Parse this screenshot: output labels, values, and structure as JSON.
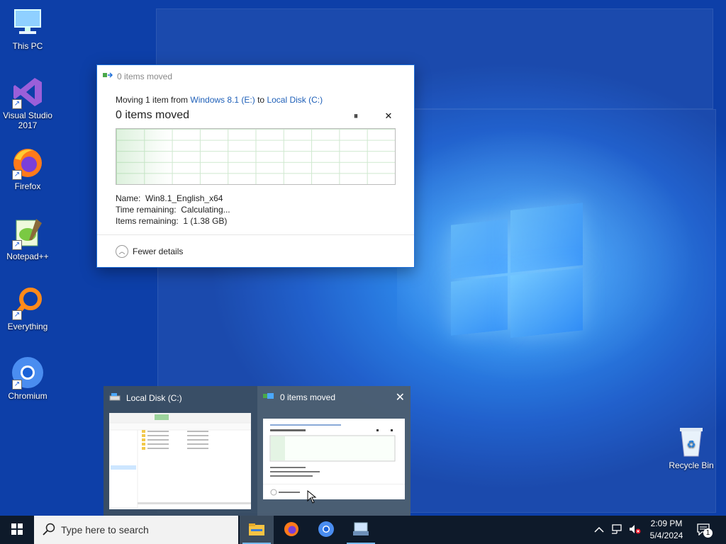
{
  "desktop_icons": [
    {
      "label": "This PC",
      "icon": "computer-icon"
    },
    {
      "label": "Visual Studio 2017",
      "icon": "visual-studio-icon"
    },
    {
      "label": "Firefox",
      "icon": "firefox-icon"
    },
    {
      "label": "Notepad++",
      "icon": "notepadpp-icon"
    },
    {
      "label": "Everything",
      "icon": "search-magnifier-icon"
    },
    {
      "label": "Chromium",
      "icon": "chromium-icon"
    },
    {
      "label": "Recycle Bin",
      "icon": "recycle-bin-icon"
    }
  ],
  "copy_dialog": {
    "title": "0 items moved",
    "moving_prefix": "Moving 1 item from",
    "source": "Windows 8.1 (E:)",
    "to_word": "to",
    "destination": "Local Disk (C:)",
    "heading": "0 items moved",
    "pause_glyph": "⏸",
    "close_glyph": "✕",
    "name_label": "Name:",
    "name_value": "Win8.1_English_x64",
    "time_label": "Time remaining:",
    "time_value": "Calculating...",
    "items_label": "Items remaining:",
    "items_value": "1 (1.38 GB)",
    "fewer_details": "Fewer details",
    "progress_fraction": 0.0
  },
  "thumbnails": {
    "explorer_title": "Local Disk (C:)",
    "dialog_title": "0 items moved",
    "close_glyph": "✕"
  },
  "taskbar": {
    "search_placeholder": "Type here to search",
    "time": "2:09 PM",
    "date": "5/4/2024",
    "notification_count": "1",
    "accent": "#76b9ed"
  }
}
